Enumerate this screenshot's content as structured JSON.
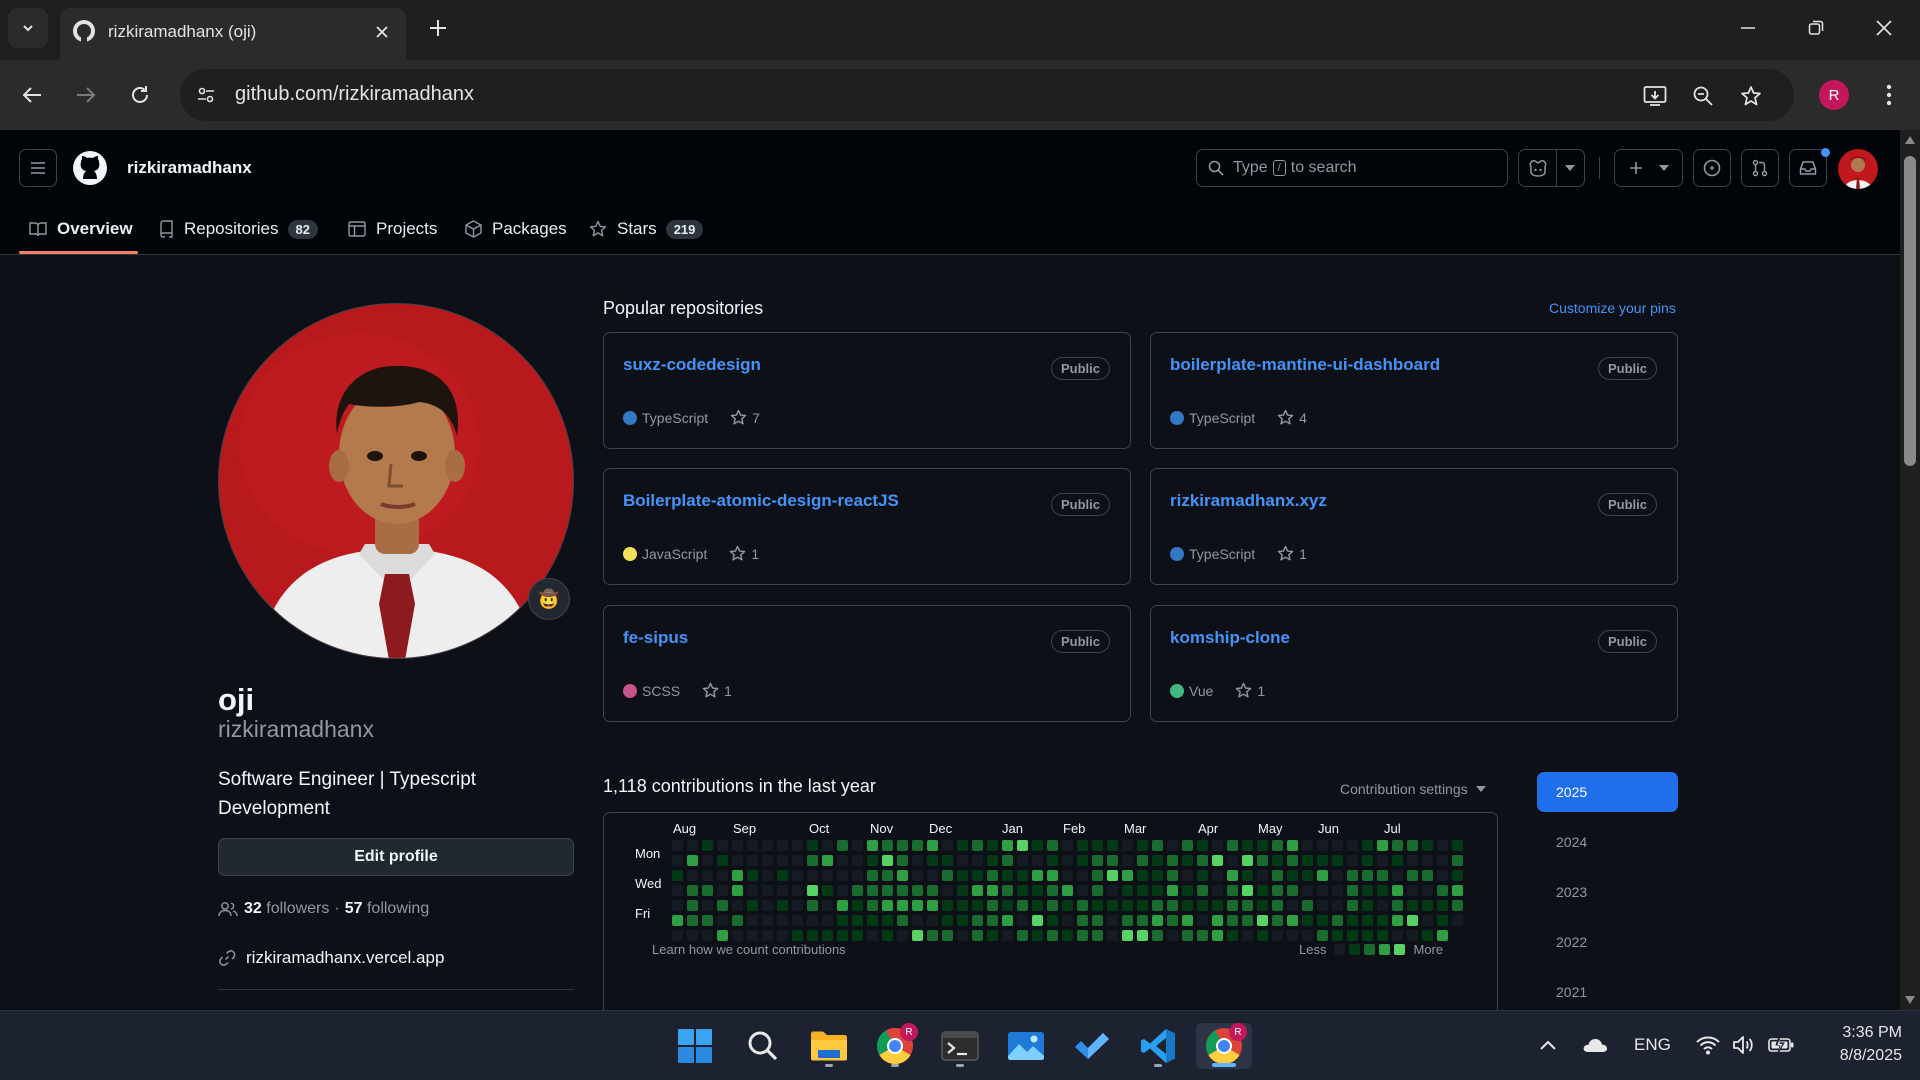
{
  "browser": {
    "tab_title": "rizkiramadhanx (oji)",
    "url": "github.com/rizkiramadhanx",
    "profile_initial": "R"
  },
  "header": {
    "username": "rizkiramadhanx",
    "search_placeholder_pre": "Type",
    "search_key": "/",
    "search_placeholder_post": "to search"
  },
  "nav": {
    "overview": "Overview",
    "repositories": "Repositories",
    "repositories_count": "82",
    "projects": "Projects",
    "packages": "Packages",
    "stars": "Stars",
    "stars_count": "219"
  },
  "profile": {
    "name": "oji",
    "login": "rizkiramadhanx",
    "bio": "Software Engineer | Typescript Development",
    "edit_button": "Edit profile",
    "followers_count": "32",
    "followers_label": "followers",
    "separator": "·",
    "following_count": "57",
    "following_label": "following",
    "website": "rizkiramadhanx.vercel.app",
    "status_emoji": "🤠"
  },
  "popular": {
    "title": "Popular repositories",
    "customize": "Customize your pins",
    "repos": [
      {
        "name": "suxz-codedesign",
        "visibility": "Public",
        "language": "TypeScript",
        "lang_color": "#3178c6",
        "stars": "7"
      },
      {
        "name": "boilerplate-mantine-ui-dashboard",
        "visibility": "Public",
        "language": "TypeScript",
        "lang_color": "#3178c6",
        "stars": "4"
      },
      {
        "name": "Boilerplate-atomic-design-reactJS",
        "visibility": "Public",
        "language": "JavaScript",
        "lang_color": "#f1e05a",
        "stars": "1"
      },
      {
        "name": "rizkiramadhanx.xyz",
        "visibility": "Public",
        "language": "TypeScript",
        "lang_color": "#3178c6",
        "stars": "1"
      },
      {
        "name": "fe-sipus",
        "visibility": "Public",
        "language": "SCSS",
        "lang_color": "#c6538c",
        "stars": "1"
      },
      {
        "name": "komship-clone",
        "visibility": "Public",
        "language": "Vue",
        "lang_color": "#41b883",
        "stars": "1"
      }
    ]
  },
  "contributions": {
    "title": "1,118 contributions in the last year",
    "settings": "Contribution settings",
    "months": [
      "Aug",
      "Sep",
      "Oct",
      "Nov",
      "Dec",
      "Jan",
      "Feb",
      "Mar",
      "Apr",
      "May",
      "Jun",
      "Jul"
    ],
    "days": [
      "Mon",
      "Wed",
      "Fri"
    ],
    "learn": "Learn how we count contributions",
    "less": "Less",
    "more": "More",
    "levels": [
      "#151b23",
      "#033a16",
      "#196c2e",
      "#2ea043",
      "#56d364"
    ],
    "years": [
      "2025",
      "2024",
      "2023",
      "2022",
      "2021"
    ],
    "selected_year": "2025"
  },
  "taskbar": {
    "time": "3:36 PM",
    "date": "8/8/2025",
    "lang": "ENG"
  },
  "colors": {
    "accent": "#4493f8",
    "year_selected": "#1f6feb",
    "nav_underline": "#f78166"
  }
}
